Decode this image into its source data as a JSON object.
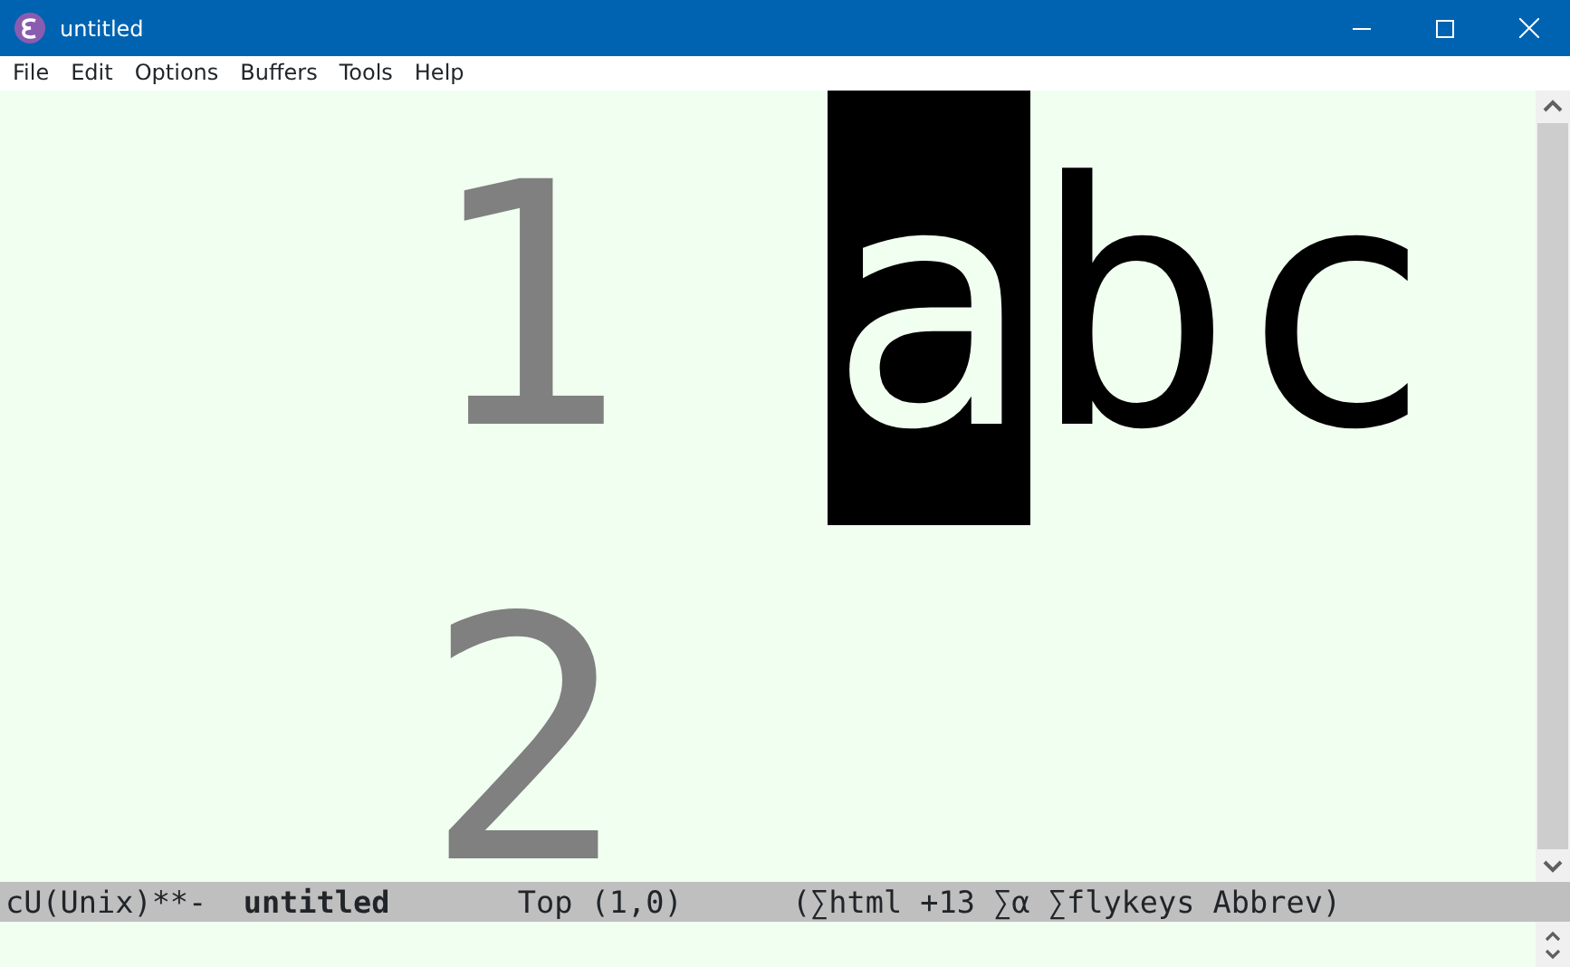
{
  "window": {
    "title": "untitled"
  },
  "menu": [
    "File",
    "Edit",
    "Options",
    "Buffers",
    "Tools",
    "Help"
  ],
  "buffer": {
    "lines": [
      {
        "number": "1",
        "segments": [
          {
            "text": "a",
            "cursor": true
          },
          {
            "text": "bc",
            "cursor": false
          }
        ]
      },
      {
        "number": "2"
      }
    ]
  },
  "mode_line": {
    "status": "cU(Unix)**-",
    "buffer_name": "untitled",
    "position": "Top (1,0)",
    "modes": "(∑html +13 ∑α ∑flykeys Abbrev)"
  }
}
